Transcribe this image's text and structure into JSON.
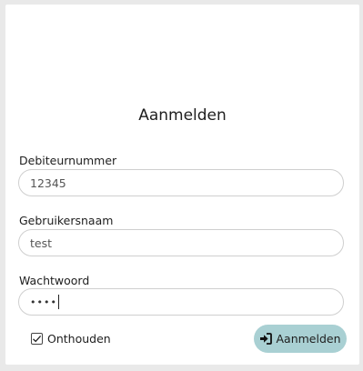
{
  "login": {
    "title": "Aanmelden",
    "fields": [
      {
        "label": "Debiteurnummer",
        "value": "12345"
      },
      {
        "label": "Gebruikersnaam",
        "value": "test"
      },
      {
        "label": "Wachtwoord",
        "value": "••••"
      }
    ],
    "remember_label": "Onthouden",
    "remember_checked": true,
    "submit_label": "Aanmelden",
    "submit_icon": "sign-in-icon"
  },
  "colors": {
    "background": "#e9e9e9",
    "card": "#ffffff",
    "button": "#a9d0d3",
    "input_border": "#cfcfcf"
  }
}
